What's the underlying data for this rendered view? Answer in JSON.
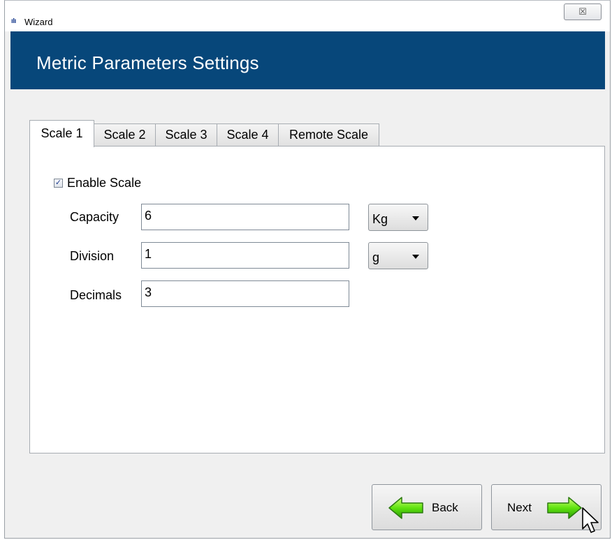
{
  "window": {
    "title": "Wizard",
    "app_icon_text": "ıIı",
    "close_glyph": "☒"
  },
  "header": {
    "title": "Metric Parameters Settings",
    "background_color": "#07477a"
  },
  "tabs": [
    {
      "label": "Scale 1",
      "active": true
    },
    {
      "label": "Scale 2",
      "active": false
    },
    {
      "label": "Scale 3",
      "active": false
    },
    {
      "label": "Scale 4",
      "active": false
    },
    {
      "label": "Remote Scale",
      "active": false
    }
  ],
  "scale": {
    "enable_label": "Enable Scale",
    "enable_checked": true,
    "check_glyph": "✓",
    "capacity": {
      "label": "Capacity",
      "value": "6",
      "unit": "Kg"
    },
    "division": {
      "label": "Division",
      "value": "1",
      "unit": "g"
    },
    "decimals": {
      "label": "Decimals",
      "value": "3"
    }
  },
  "buttons": {
    "back_label": "Back",
    "next_label": "Next"
  },
  "icons": {
    "back": "green-left-arrow-icon",
    "next": "green-right-arrow-icon",
    "cursor": "mouse-pointer-icon"
  }
}
